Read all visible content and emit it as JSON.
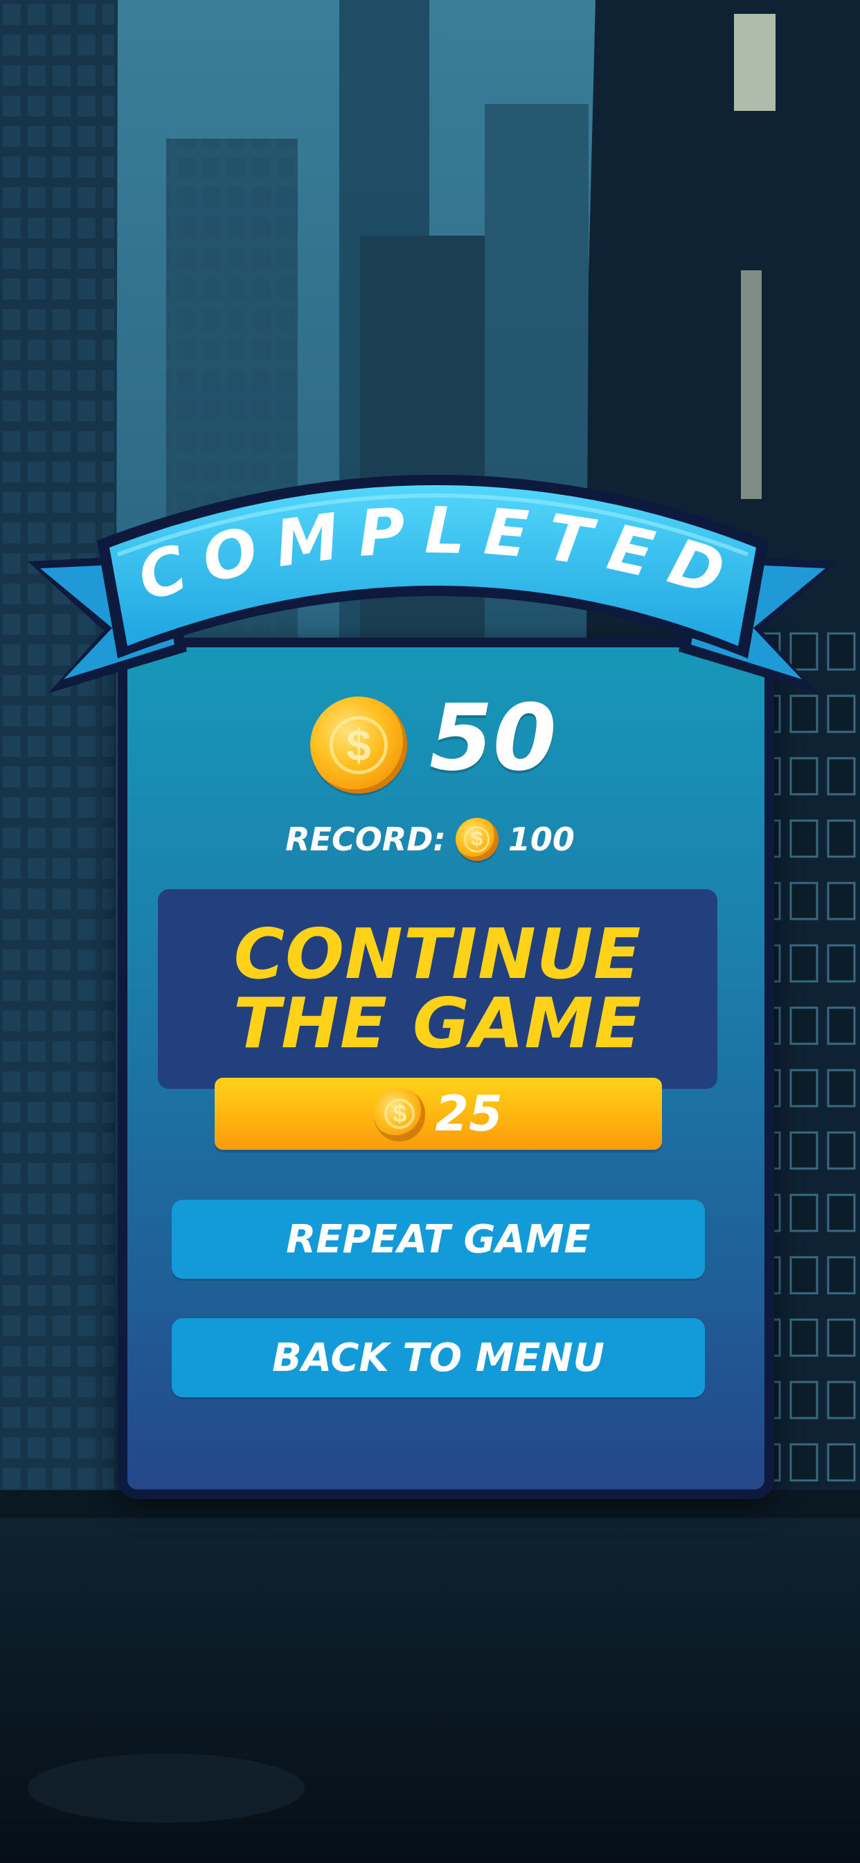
{
  "banner": {
    "title": "COMPLETED"
  },
  "score": {
    "coins": "50",
    "coin_icon": "coin-icon"
  },
  "record": {
    "label": "RECORD:",
    "value": "100"
  },
  "continue_offer": {
    "line1": "CONTINUE",
    "line2": "THE GAME",
    "cost": "25"
  },
  "buttons": {
    "repeat": "REPEAT GAME",
    "menu": "BACK TO MENU"
  },
  "colors": {
    "banner": "#37c4f0",
    "panel_top": "#1797b8",
    "panel_bottom": "#24478a",
    "gold": "#ffd21a",
    "button": "#139ad8",
    "card": "#223f7e"
  }
}
